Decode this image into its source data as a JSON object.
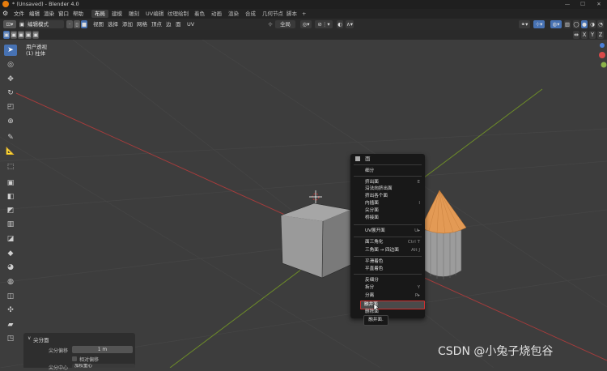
{
  "window": {
    "title": "* (Unsaved) - Blender 4.0",
    "minimize": "—",
    "maximize": "☐",
    "close": "✕"
  },
  "menu": [
    "文件",
    "编辑",
    "渲染",
    "窗口",
    "帮助"
  ],
  "workspaces": [
    "布局",
    "建模",
    "雕刻",
    "UV编辑",
    "纹理绘制",
    "着色",
    "动画",
    "渲染",
    "合成",
    "几何节点",
    "脚本",
    "+"
  ],
  "active_workspace": "布局",
  "header": {
    "mode": "编辑模式",
    "view_menus": [
      "视图",
      "选择",
      "添加",
      "网格",
      "顶点",
      "边",
      "面",
      "UV"
    ],
    "orientation": "全局"
  },
  "subheader": {
    "axes": [
      "X",
      "Y",
      "Z"
    ]
  },
  "viewport": {
    "view_name": "用户透视",
    "object_name": "(1) 柱体"
  },
  "tools": [
    "select-box",
    "cursor",
    "move",
    "rotate",
    "scale",
    "transform",
    "annotate",
    "measure",
    "add-cube",
    "extrude",
    "inset",
    "bevel",
    "loop-cut",
    "knife",
    "poly-build",
    "spin",
    "smooth",
    "edge-slide",
    "shrink-fatten",
    "shear",
    "rip"
  ],
  "context_menu": {
    "header": "面",
    "groups": [
      [
        {
          "label": "细分",
          "shortcut": ""
        }
      ],
      [
        {
          "label": "挤出面",
          "shortcut": "E"
        },
        {
          "label": "沿法向挤出面",
          "shortcut": ""
        },
        {
          "label": "挤出各个面",
          "shortcut": ""
        },
        {
          "label": "内插面",
          "shortcut": "I"
        },
        {
          "label": "尖分面",
          "shortcut": ""
        },
        {
          "label": "桥接面",
          "shortcut": ""
        }
      ],
      [
        {
          "label": "UV展开面",
          "shortcut": "U▸"
        }
      ],
      [
        {
          "label": "面三角化",
          "shortcut": "Ctrl T"
        },
        {
          "label": "三角面 → 四边面",
          "shortcut": "Alt J"
        }
      ],
      [
        {
          "label": "平滑着色",
          "shortcut": ""
        },
        {
          "label": "平直着色",
          "shortcut": ""
        }
      ],
      [
        {
          "label": "反细分",
          "shortcut": ""
        },
        {
          "label": "拆分",
          "shortcut": "Y"
        },
        {
          "label": "分离",
          "shortcut": "P▸"
        },
        {
          "label": "融并面",
          "shortcut": ""
        },
        {
          "label": "删除面",
          "shortcut": ""
        }
      ]
    ],
    "highlighted": "融并面",
    "tooltip": "融并面."
  },
  "operator_panel": {
    "title": "尖分面",
    "offset_label": "尖分偏移",
    "offset_value": "1 m",
    "relative_label": "相对偏移",
    "center_label": "尖分中心",
    "center_value": "加权重心"
  },
  "watermark": "CSDN @小兔子烧包谷",
  "colors": {
    "accent": "#4772b3",
    "highlight_border": "#d03030",
    "cone_orange": "#e39a55",
    "x_axis": "#a43c3c",
    "y_axis": "#6d8c28"
  }
}
